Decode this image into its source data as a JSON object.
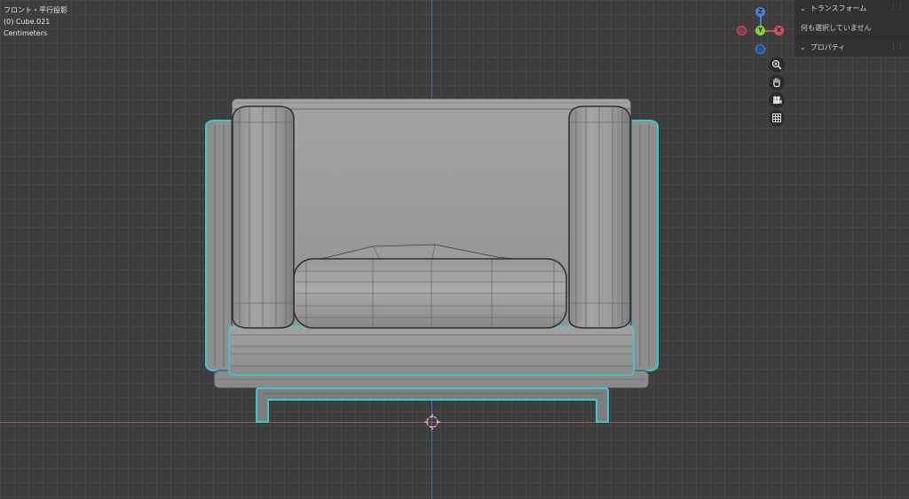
{
  "viewport": {
    "view_name": "フロント・平行投影",
    "object_label": "(0) Cube.021",
    "units": "Centimeters"
  },
  "sidebar": {
    "transform_header": "トランスフォーム",
    "transform_empty": "何も選択していません",
    "properties_header": "プロパティ"
  },
  "gizmo": {
    "z": "Z",
    "y": "Y",
    "x": "X"
  },
  "nav": [
    "zoom-icon",
    "hand-pan-icon",
    "camera-icon",
    "grid-view-icon"
  ],
  "colors": {
    "background": "#3d3d3d",
    "selection_outline": "#3cc8d2",
    "axis_x": "#b44b55",
    "axis_z": "#4f6fb4"
  }
}
